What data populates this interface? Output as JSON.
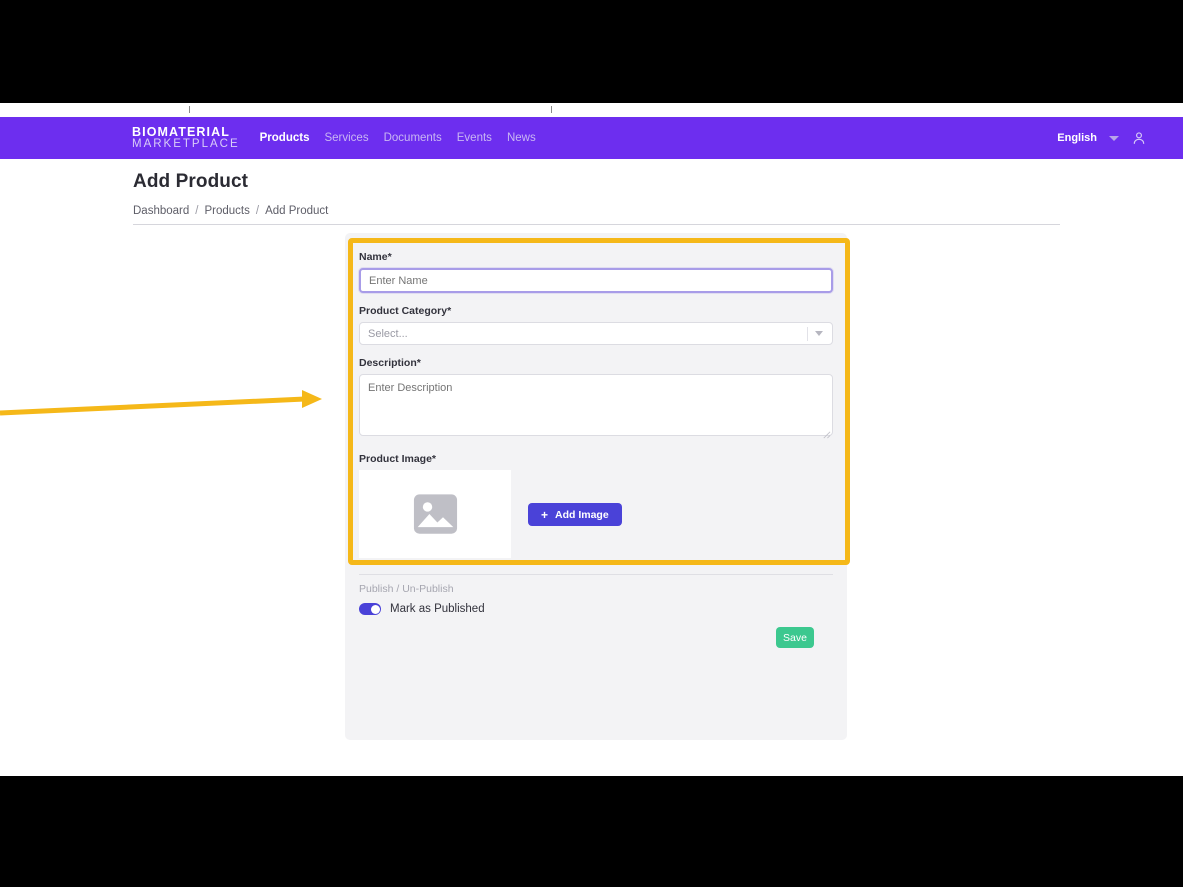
{
  "navbar": {
    "brand_line1": "BIOMATERIAL",
    "brand_line2": "MARKETPLACE",
    "links": [
      {
        "label": "Products",
        "active": true
      },
      {
        "label": "Services",
        "active": false
      },
      {
        "label": "Documents",
        "active": false
      },
      {
        "label": "Events",
        "active": false
      },
      {
        "label": "News",
        "active": false
      }
    ],
    "language": "English",
    "language_chevron_icon": "chevron-down-icon",
    "account_icon": "user-account-icon",
    "background_color": "#6d2eef"
  },
  "header": {
    "title": "Add Product",
    "breadcrumb": [
      {
        "label": "Dashboard"
      },
      {
        "label": "Products"
      },
      {
        "label": "Add Product"
      }
    ],
    "breadcrumb_separator": "/"
  },
  "form": {
    "name": {
      "label": "Name*",
      "placeholder": "Enter Name",
      "value": "",
      "focused": true
    },
    "category": {
      "label": "Product Category*",
      "selected": "Select...",
      "chevron_icon": "chevron-down-icon"
    },
    "description": {
      "label": "Description*",
      "placeholder": "Enter Description",
      "value": ""
    },
    "product_image": {
      "label": "Product Image*",
      "placeholder_icon": "image-placeholder-icon",
      "add_button_label": "Add Image",
      "add_button_icon": "plus-icon",
      "add_button_color": "#4a42d8"
    },
    "publish": {
      "section_label": "Publish / Un-Publish",
      "toggle_label": "Mark as Published",
      "toggle_on": true,
      "toggle_color": "#4a42d8"
    },
    "save_label": "Save",
    "save_color": "#3cc88f"
  },
  "annotations": {
    "highlight_color": "#f5b819",
    "arrow_color": "#f5b819",
    "arrow_direction": "right"
  }
}
